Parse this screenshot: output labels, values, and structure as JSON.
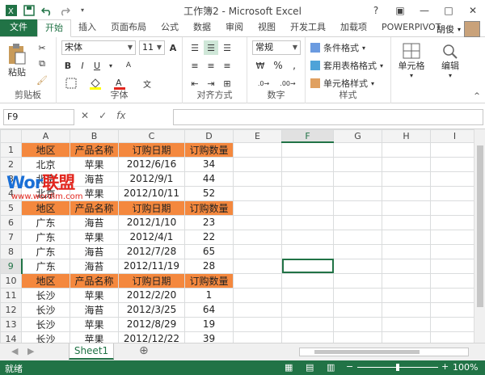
{
  "window": {
    "title": "工作簿2 - Microsoft Excel",
    "user": "胡俊"
  },
  "tabs": [
    "文件",
    "开始",
    "插入",
    "页面布局",
    "公式",
    "数据",
    "审阅",
    "视图",
    "开发工具",
    "加载项",
    "POWERPIVOT"
  ],
  "ribbon": {
    "clipboard": {
      "label": "剪贴板",
      "paste": "粘贴"
    },
    "font": {
      "label": "字体",
      "name": "宋体",
      "size": "11",
      "bold": "B",
      "italic": "I",
      "underline": "U",
      "grow": "A",
      "shrink": "A"
    },
    "alignment": {
      "label": "对齐方式"
    },
    "number": {
      "label": "数字",
      "format": "常规",
      "percent": "%",
      "comma": ","
    },
    "styles": {
      "label": "样式",
      "conditional": "条件格式",
      "table": "套用表格格式",
      "cell": "单元格样式"
    },
    "cells": {
      "label": "单元格"
    },
    "editing": {
      "label": "编辑"
    }
  },
  "formula_bar": {
    "name_box": "F9",
    "fx": "fx",
    "content": ""
  },
  "columns": [
    "A",
    "B",
    "C",
    "D",
    "E",
    "F",
    "G",
    "H",
    "I"
  ],
  "rows": [
    {
      "n": "1",
      "cells": [
        "地区",
        "产品名称",
        "订购日期",
        "订购数量"
      ],
      "header": true
    },
    {
      "n": "2",
      "cells": [
        "北京",
        "苹果",
        "2012/6/16",
        "34"
      ]
    },
    {
      "n": "3",
      "cells": [
        "北京",
        "海苔",
        "2012/9/1",
        "44"
      ]
    },
    {
      "n": "4",
      "cells": [
        "北京",
        "苹果",
        "2012/10/11",
        "52"
      ]
    },
    {
      "n": "5",
      "cells": [
        "地区",
        "产品名称",
        "订购日期",
        "订购数量"
      ],
      "header": true
    },
    {
      "n": "6",
      "cells": [
        "广东",
        "海苔",
        "2012/1/10",
        "23"
      ]
    },
    {
      "n": "7",
      "cells": [
        "广东",
        "苹果",
        "2012/4/1",
        "22"
      ]
    },
    {
      "n": "8",
      "cells": [
        "广东",
        "海苔",
        "2012/7/28",
        "65"
      ]
    },
    {
      "n": "9",
      "cells": [
        "广东",
        "海苔",
        "2012/11/19",
        "28"
      ]
    },
    {
      "n": "10",
      "cells": [
        "地区",
        "产品名称",
        "订购日期",
        "订购数量"
      ],
      "header": true
    },
    {
      "n": "11",
      "cells": [
        "长沙",
        "苹果",
        "2012/2/20",
        "1"
      ]
    },
    {
      "n": "12",
      "cells": [
        "长沙",
        "海苔",
        "2012/3/25",
        "64"
      ]
    },
    {
      "n": "13",
      "cells": [
        "长沙",
        "苹果",
        "2012/8/29",
        "19"
      ]
    },
    {
      "n": "14",
      "cells": [
        "长沙",
        "苹果",
        "2012/12/22",
        "39"
      ]
    },
    {
      "n": "15",
      "cells": [
        "",
        "",
        "",
        ""
      ]
    },
    {
      "n": "16",
      "cells": [
        "",
        "",
        "",
        ""
      ]
    }
  ],
  "watermark": {
    "brand_a": "Wor",
    "brand_b": "联盟",
    "url": "www.wordlm.com"
  },
  "sheet_tabs": [
    "Sheet1"
  ],
  "status": {
    "mode": "就绪",
    "zoom": "100%"
  },
  "colors": {
    "accent": "#217346",
    "header_fill": "#f4883e"
  }
}
